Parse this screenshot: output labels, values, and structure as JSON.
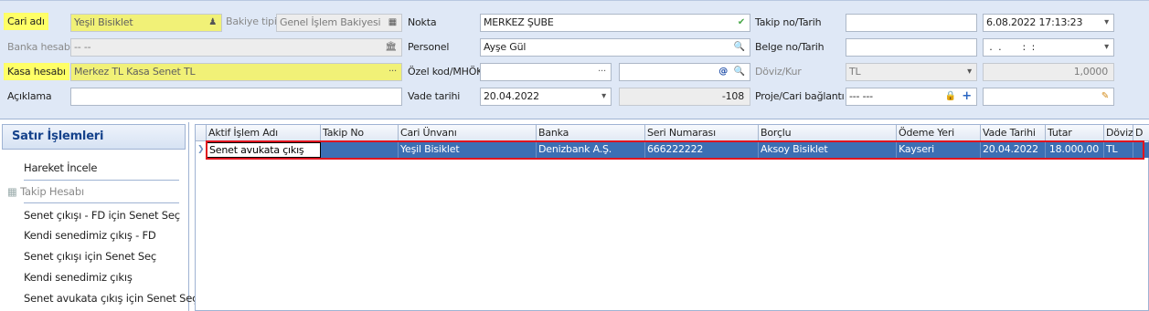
{
  "form": {
    "left": [
      {
        "label": "Cari adı",
        "value": "Yeşil Bisiklet",
        "icon": "people-icon"
      },
      {
        "label": "Banka hesabı",
        "value": "-- --",
        "icon": "bank-icon"
      },
      {
        "label": "Kasa hesabı",
        "value": "Merkez TL Kasa Senet TL",
        "icon": "ellipsis"
      },
      {
        "label": "Açıklama",
        "value": ""
      }
    ],
    "bakiye": {
      "label": "Bakiye tipi",
      "value": "Genel İşlem Bakiyesi",
      "icon": "calculator-icon"
    },
    "middle": [
      {
        "label": "Nokta",
        "value": "MERKEZ ŞUBE",
        "icon": "check-icon"
      },
      {
        "label": "Personel",
        "value": "Ayşe Gül",
        "icon": "search-person-icon"
      },
      {
        "label": "Özel kod/MHÖK",
        "value": "",
        "icon": "ellipsis"
      },
      {
        "label": "Vade tarihi",
        "value": "20.04.2022",
        "icon": "dropdown"
      }
    ],
    "ozel_kod2": {
      "value": "",
      "icon1": "at-icon",
      "icon2": "search-icon"
    },
    "vade_days": "-108",
    "right": [
      {
        "label": "Takip no/Tarih",
        "value": "",
        "date": "6.08.2022 17:13:23"
      },
      {
        "label": "Belge no/Tarih",
        "value": "",
        "date": " .  .       :  :"
      },
      {
        "label": "Döviz/Kur",
        "value": "TL",
        "date": "1,0000"
      },
      {
        "label": "Proje/Cari bağlantı",
        "value": "--- ---",
        "date": ""
      }
    ]
  },
  "panel": {
    "title": "Satır İşlemleri",
    "items": [
      {
        "label": "Hareket İncele",
        "enabled": true
      },
      {
        "label": "Takip Hesabı",
        "enabled": false
      },
      {
        "label": "Senet çıkışı - FD için Senet Seç",
        "enabled": true
      },
      {
        "label": "Kendi senedimiz çıkış - FD",
        "enabled": true
      },
      {
        "label": "Senet çıkışı için Senet Seç",
        "enabled": true
      },
      {
        "label": "Kendi senedimiz çıkış",
        "enabled": true
      },
      {
        "label": "Senet avukata çıkış için Senet Seç",
        "enabled": true
      }
    ]
  },
  "grid": {
    "columns": [
      "Aktif İşlem Adı",
      "Takip No",
      "Cari Ünvanı",
      "Banka",
      "Seri Numarası",
      "Borçlu",
      "Ödeme Yeri",
      "Vade Tarihi",
      "Tutar",
      "Döviz",
      "D"
    ],
    "rows": [
      {
        "cells": [
          "Senet avukata çıkış",
          "",
          "Yeşil Bisiklet",
          "Denizbank A.Ş.",
          "666222222",
          "Aksoy Bisiklet",
          "Kayseri",
          "20.04.2022",
          "18.000,00",
          "TL",
          ""
        ]
      }
    ]
  },
  "colors": {
    "highlight": "#ffff66",
    "selection": "#3c6fb4",
    "annotation": "#e0141e"
  }
}
